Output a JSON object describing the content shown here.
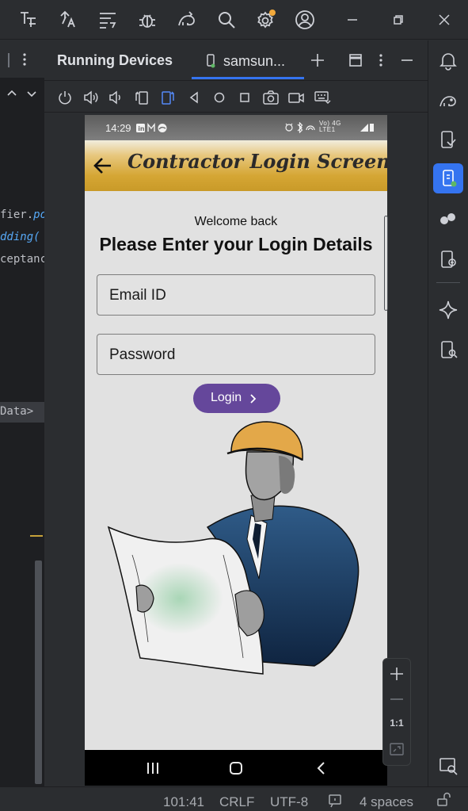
{
  "editor": {
    "lines": [
      "fier.",
      "po",
      "dding(",
      "ceptanc",
      "Data>"
    ]
  },
  "panel": {
    "title": "Running Devices",
    "device_tab": "samsun..."
  },
  "app": {
    "status_time": "14:29",
    "status_right": "Vo) 4G LTE1",
    "title": "Contractor Login Screen",
    "welcome": "Welcome back",
    "heading": "Please Enter your Login Details",
    "email_placeholder": "Email ID",
    "password_placeholder": "Password",
    "login_label": "Login"
  },
  "zoom": {
    "reset_label": "1:1"
  },
  "statusbar": {
    "position": "101:41",
    "line_endings": "CRLF",
    "encoding": "UTF-8",
    "indent": "4 spaces"
  },
  "colors": {
    "accent": "#3574f0",
    "app_button": "#65479b",
    "app_bar_gold": "#d5a634"
  }
}
